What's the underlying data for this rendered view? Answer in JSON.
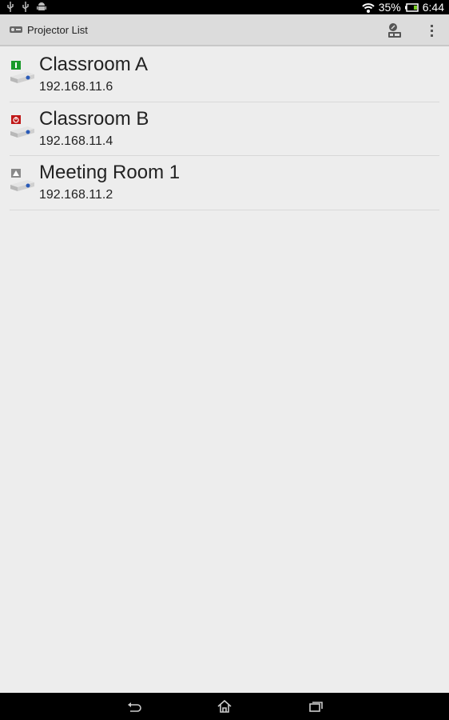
{
  "status_bar": {
    "left_icons": [
      "usb-icon",
      "usb-icon",
      "android-icon"
    ],
    "wifi_icon": "wifi-icon",
    "battery_percent": "35%",
    "battery_icon": "battery-icon",
    "time": "6:44"
  },
  "action_bar": {
    "app_icon": "projector-icon",
    "title": "Projector List",
    "settings_icon": "projector-settings-icon",
    "overflow_icon": "overflow-menu-icon"
  },
  "projectors": [
    {
      "name": "Classroom A",
      "ip": "192.168.11.6",
      "status": "on",
      "status_color": "#1a9a2a"
    },
    {
      "name": "Classroom B",
      "ip": "192.168.11.4",
      "status": "standby",
      "status_color": "#c01818"
    },
    {
      "name": "Meeting Room 1",
      "ip": "192.168.11.2",
      "status": "warning",
      "status_color": "#8a8a8a"
    }
  ],
  "nav_bar": {
    "back_icon": "back-icon",
    "home_icon": "home-icon",
    "recents_icon": "recent-apps-icon"
  }
}
